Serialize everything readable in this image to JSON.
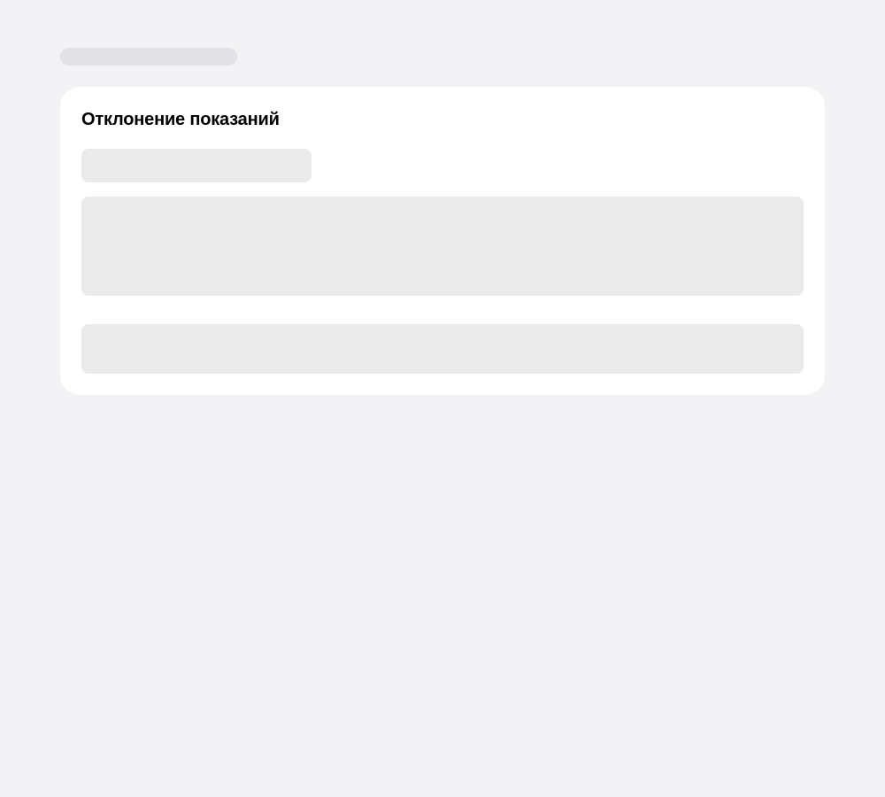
{
  "page": {
    "background_color": "#f3f3f5",
    "skeleton_color": "#eaeaea"
  },
  "card": {
    "title": "Отклонение показаний"
  }
}
